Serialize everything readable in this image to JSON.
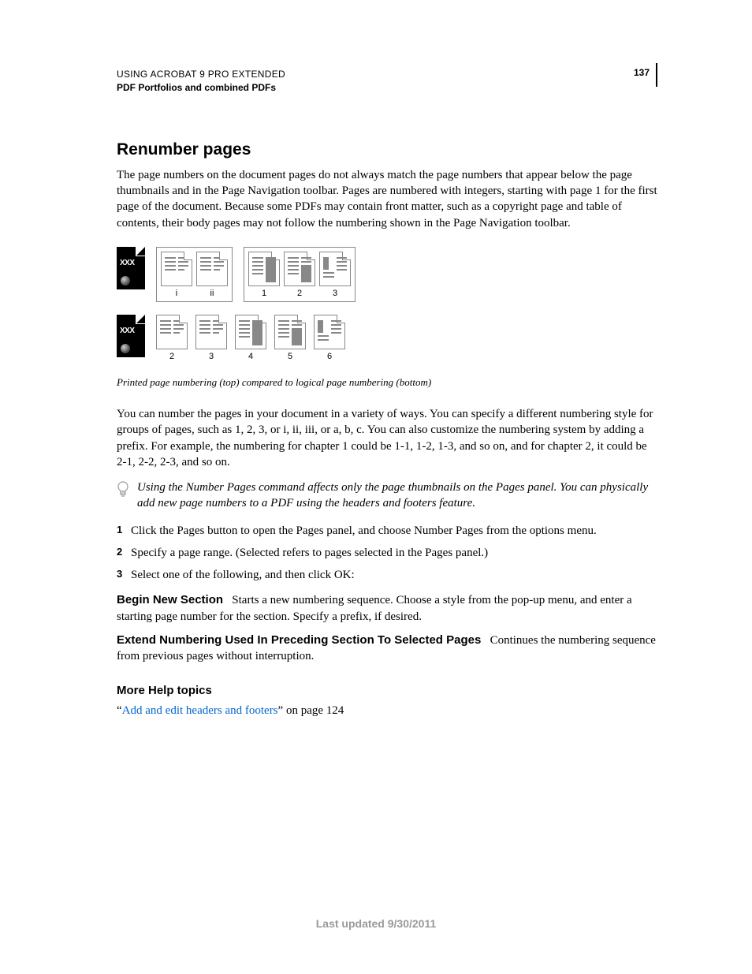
{
  "header": {
    "line1": "USING ACROBAT 9 PRO EXTENDED",
    "line2": "PDF Portfolios and combined PDFs",
    "page_number": "137"
  },
  "section": {
    "title": "Renumber pages",
    "intro": "The page numbers on the document pages do not always match the page numbers that appear below the page thumbnails and in the Page Navigation toolbar. Pages are numbered with integers, starting with page 1 for the first page of the document. Because some PDFs may contain front matter, such as a copyright page and table of contents, their body pages may not follow the numbering shown in the Page Navigation toolbar."
  },
  "figure": {
    "cover_text": "XXX",
    "row1_labels": [
      "i",
      "ii",
      "1",
      "2",
      "3"
    ],
    "row2_labels": [
      "2",
      "3",
      "4",
      "5",
      "6"
    ],
    "caption": "Printed page numbering (top) compared to logical page numbering (bottom)"
  },
  "body": {
    "para2": "You can number the pages in your document in a variety of ways. You can specify a different numbering style for groups of pages, such as 1, 2, 3, or i, ii, iii, or a, b, c. You can also customize the numbering system by adding a prefix. For example, the numbering for chapter 1 could be 1-1, 1-2, 1-3, and so on, and for chapter 2, it could be 2-1, 2-2, 2-3, and so on.",
    "tip": "Using the Number Pages command affects only the page thumbnails on the Pages panel. You can physically add new page numbers to a PDF using the headers and footers feature.",
    "steps": [
      "Click the Pages button to open the Pages panel, and choose Number Pages from the options menu.",
      "Specify a page range. (Selected refers to pages selected in the Pages panel.)",
      "Select one of the following, and then click OK:"
    ],
    "options": [
      {
        "term": "Begin New Section",
        "desc": "Starts a new numbering sequence. Choose a style from the pop-up menu, and enter a starting page number for the section. Specify a prefix, if desired."
      },
      {
        "term": "Extend Numbering Used In Preceding Section To Selected Pages",
        "desc": "Continues the numbering sequence from previous pages without interruption."
      }
    ]
  },
  "more_help": {
    "heading": "More Help topics",
    "quote_open": "“",
    "link_text": "Add and edit headers and footers",
    "suffix": "” on page 124"
  },
  "footer": {
    "text": "Last updated 9/30/2011"
  }
}
